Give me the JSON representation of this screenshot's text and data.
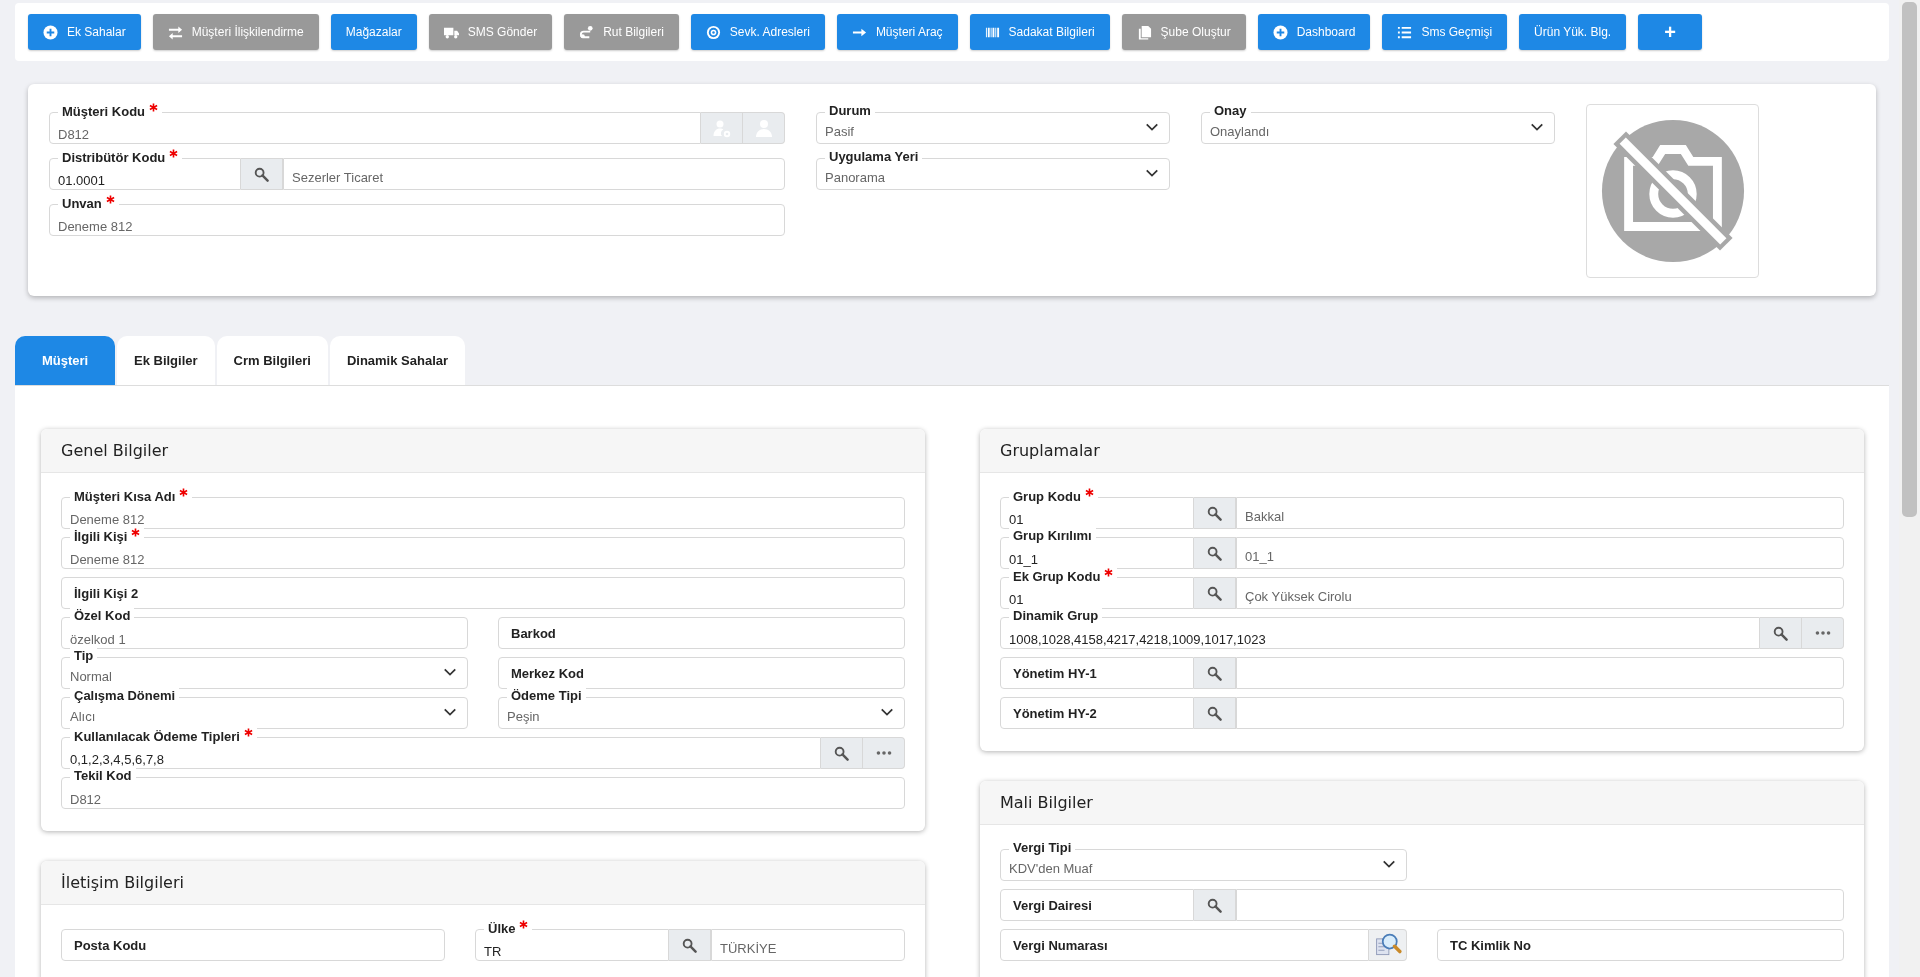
{
  "toolbar": {
    "buttons": [
      {
        "label": "Ek Sahalar",
        "disabled": false
      },
      {
        "label": "Müşteri İlişkilendirme",
        "disabled": true
      },
      {
        "label": "Mağazalar",
        "disabled": false
      },
      {
        "label": "SMS Gönder",
        "disabled": true
      },
      {
        "label": "Rut Bilgileri",
        "disabled": true
      },
      {
        "label": "Sevk. Adresleri",
        "disabled": false
      },
      {
        "label": "Müşteri Araç",
        "disabled": false
      },
      {
        "label": "Sadakat Bilgileri",
        "disabled": false
      },
      {
        "label": "Şube Oluştur",
        "disabled": true
      },
      {
        "label": "Dashboard",
        "disabled": false
      },
      {
        "label": "Sms Geçmişi",
        "disabled": false
      },
      {
        "label": "Ürün Yük. Blg.",
        "disabled": false
      },
      {
        "label": "+",
        "disabled": false
      }
    ]
  },
  "header": {
    "columns": [
      [
        {
          "kind": "avatar",
          "label": "Müşteri Kodu",
          "required": true,
          "value": "D812"
        },
        {
          "kind": "lookup",
          "label": "Distribütör Kodu",
          "required": true,
          "value": "01.0001",
          "description": "Sezerler Ticaret"
        },
        {
          "kind": "text",
          "label": "Unvan",
          "required": true,
          "value": "Deneme 812"
        }
      ],
      [
        {
          "kind": "select",
          "label": "Durum",
          "required": false,
          "value": "Pasif"
        },
        {
          "kind": "select",
          "label": "Uygulama Yeri",
          "required": false,
          "value": "Panorama"
        }
      ],
      [
        {
          "kind": "select",
          "label": "Onay",
          "required": false,
          "value": "Onaylandı"
        }
      ]
    ]
  },
  "tabs": [
    {
      "label": "Müşteri",
      "selected": true
    },
    {
      "label": "Ek Bilgiler",
      "selected": false
    },
    {
      "label": "Crm Bilgileri",
      "selected": false
    },
    {
      "label": "Dinamik Sahalar",
      "selected": false
    }
  ],
  "panels": {
    "left": [
      {
        "title": "Genel Bilgiler",
        "rows": [
          [
            {
              "kind": "text",
              "label": "Müşteri Kısa Adı",
              "required": true,
              "value": "Deneme 812"
            }
          ],
          [
            {
              "kind": "text",
              "label": "İlgili Kişi",
              "required": true,
              "value": "Deneme 812"
            }
          ],
          [
            {
              "kind": "text",
              "label": "İlgili Kişi 2",
              "required": false
            }
          ],
          [
            {
              "kind": "text",
              "label": "Özel Kod",
              "required": false,
              "value": "özelkod 1"
            },
            {
              "kind": "text",
              "label": "Barkod",
              "required": false
            }
          ],
          [
            {
              "kind": "select",
              "label": "Tip",
              "required": false,
              "value": "Normal"
            },
            {
              "kind": "text",
              "label": "Merkez Kod",
              "required": false
            }
          ],
          [
            {
              "kind": "select",
              "label": "Çalışma Dönemi",
              "required": false,
              "value": "Alıcı"
            },
            {
              "kind": "select",
              "label": "Ödeme Tipi",
              "required": false,
              "value": "Peşin"
            }
          ],
          [
            {
              "kind": "multi",
              "label": "Kullanılacak Ödeme Tipleri",
              "required": true,
              "value": "0,1,2,3,4,5,6,7,8"
            }
          ],
          [
            {
              "kind": "text",
              "label": "Tekil Kod",
              "required": false,
              "value": "D812"
            }
          ]
        ]
      },
      {
        "title": "İletişim Bilgileri",
        "rows": [
          [
            {
              "kind": "text",
              "label": "Posta Kodu",
              "required": false
            },
            {
              "kind": "lookup",
              "label": "Ülke",
              "required": true,
              "value": "TR",
              "description": "TÜRKİYE"
            }
          ]
        ]
      }
    ],
    "right": [
      {
        "title": "Gruplamalar",
        "rows": [
          [
            {
              "kind": "lookup",
              "label": "Grup Kodu",
              "required": true,
              "value": "01",
              "description": "Bakkal"
            }
          ],
          [
            {
              "kind": "lookup",
              "label": "Grup Kırılımı",
              "required": false,
              "value": "01_1",
              "description": "01_1"
            }
          ],
          [
            {
              "kind": "lookup",
              "label": "Ek Grup Kodu",
              "required": true,
              "value": "01",
              "description": "Çok Yüksek Cirolu"
            }
          ],
          [
            {
              "kind": "multi",
              "label": "Dinamik Grup",
              "required": false,
              "value": "1008,1028,4158,4217,4218,1009,1017,1023"
            }
          ],
          [
            {
              "kind": "lookup",
              "label": "Yönetim HY-1",
              "required": false
            }
          ],
          [
            {
              "kind": "lookup",
              "label": "Yönetim HY-2",
              "required": false
            }
          ]
        ]
      },
      {
        "title": "Mali Bilgiler",
        "rows": [
          [
            {
              "kind": "select",
              "label": "Vergi Tipi",
              "required": false,
              "value": "KDV'den Muaf"
            },
            null
          ],
          [
            {
              "kind": "lookup",
              "label": "Vergi Dairesi",
              "required": false
            }
          ],
          [
            {
              "kind": "taxsearch",
              "label": "Vergi Numarası",
              "required": false
            },
            {
              "kind": "text",
              "label": "TC Kimlik No",
              "required": false
            }
          ]
        ]
      }
    ]
  }
}
